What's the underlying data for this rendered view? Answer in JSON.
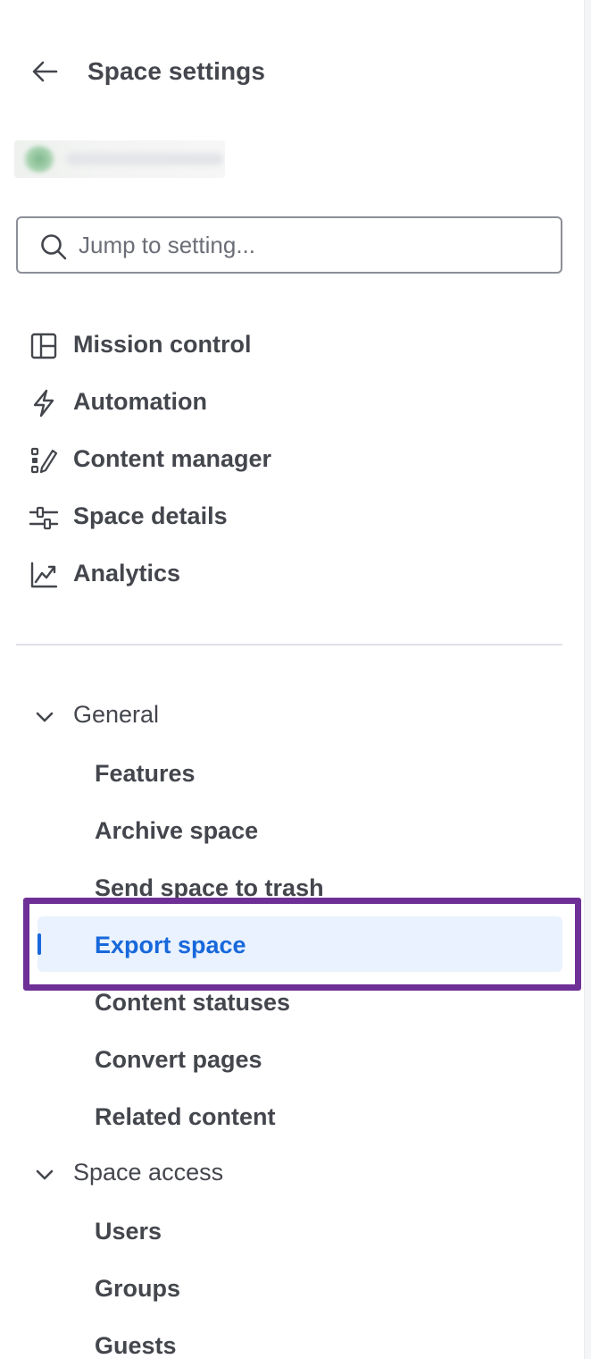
{
  "header": {
    "title": "Space settings",
    "back_icon": "arrow-left-icon"
  },
  "space": {
    "avatar_color": "#7fb88c"
  },
  "search": {
    "placeholder": "Jump to setting...",
    "value": ""
  },
  "nav": {
    "items": [
      {
        "label": "Mission control",
        "icon": "layout-panel-icon"
      },
      {
        "label": "Automation",
        "icon": "lightning-bolt-icon"
      },
      {
        "label": "Content manager",
        "icon": "content-edit-icon"
      },
      {
        "label": "Space details",
        "icon": "sliders-icon"
      },
      {
        "label": "Analytics",
        "icon": "line-chart-icon"
      }
    ]
  },
  "sections": [
    {
      "label": "General",
      "expanded": true,
      "items": [
        {
          "label": "Features"
        },
        {
          "label": "Archive space"
        },
        {
          "label": "Send space to trash"
        },
        {
          "label": "Export space",
          "selected": true
        },
        {
          "label": "Content statuses"
        },
        {
          "label": "Convert pages"
        },
        {
          "label": "Related content"
        }
      ]
    },
    {
      "label": "Space access",
      "expanded": true,
      "items": [
        {
          "label": "Users"
        },
        {
          "label": "Groups"
        },
        {
          "label": "Guests"
        }
      ]
    }
  ],
  "colors": {
    "accent": "#1868db",
    "selected_bg": "#e9f2fe",
    "highlight_frame": "#6e2f96",
    "text": "#44464d"
  }
}
